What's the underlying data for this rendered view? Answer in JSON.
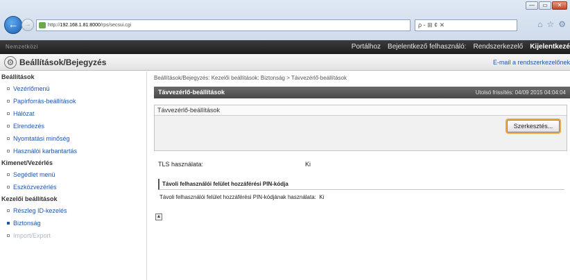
{
  "browser": {
    "url_host": "192.168.1.81:8000",
    "url_prefix": "http://",
    "url_path": "/rps/secsui.cgi",
    "search": "ρ - ⊞ ¢ ✕",
    "window_buttons": [
      "—",
      "▭",
      "✕"
    ],
    "toolbar_icons": [
      "⌂",
      "☆",
      "⚙"
    ]
  },
  "topbar": {
    "brand": "Nemzetközi",
    "links": [
      "Portálhoz",
      "Bejelentkező felhasználó:",
      "Rendszerkezelő"
    ],
    "logout": "Kijelentkezé"
  },
  "header": {
    "title": "Beállítások/Bejegyzés",
    "mail_link": "E-mail a rendszerkezelőnek"
  },
  "sidebar": {
    "sections": [
      {
        "label": "Beállítások",
        "items": [
          {
            "label": "Vezérlőmenü"
          },
          {
            "label": "Papírforrás-beállítások"
          },
          {
            "label": "Hálózat"
          },
          {
            "label": "Elrendezés"
          },
          {
            "label": "Nyomtatási minőség"
          },
          {
            "label": "Használói karbantartás"
          }
        ]
      },
      {
        "label": "Kimenet/Vezérlés",
        "items": [
          {
            "label": "Segédlet menü"
          },
          {
            "label": "Eszközvezérlés"
          }
        ]
      },
      {
        "label": "Kezelői beállítások",
        "items": [
          {
            "label": "Részleg ID-kezelés"
          },
          {
            "label": "Biztonság"
          },
          {
            "label": "Import/Export"
          }
        ]
      }
    ]
  },
  "main": {
    "breadcrumb": "Beállítások/Bejegyzés: Kezelői beállítások: Biztonság > Távvezérlő-beállítások",
    "panel_title": "Távvezérlő-beállítások",
    "updated": "Utolsó frissítés: 04/09 2015 04:04:04",
    "box_title": "Távvezérlő-beállítások",
    "edit_button": "Szerkesztés...",
    "tls_label": "TLS használata:",
    "tls_value": "Ki",
    "pin_section": "Távoli felhasználói felület hozzáférési PIN-kódja",
    "pin_label": "Távoli felhasználói felület hozzáférési PIN-kódjának használata:",
    "pin_value": "Ki",
    "top_icon": "▲"
  }
}
